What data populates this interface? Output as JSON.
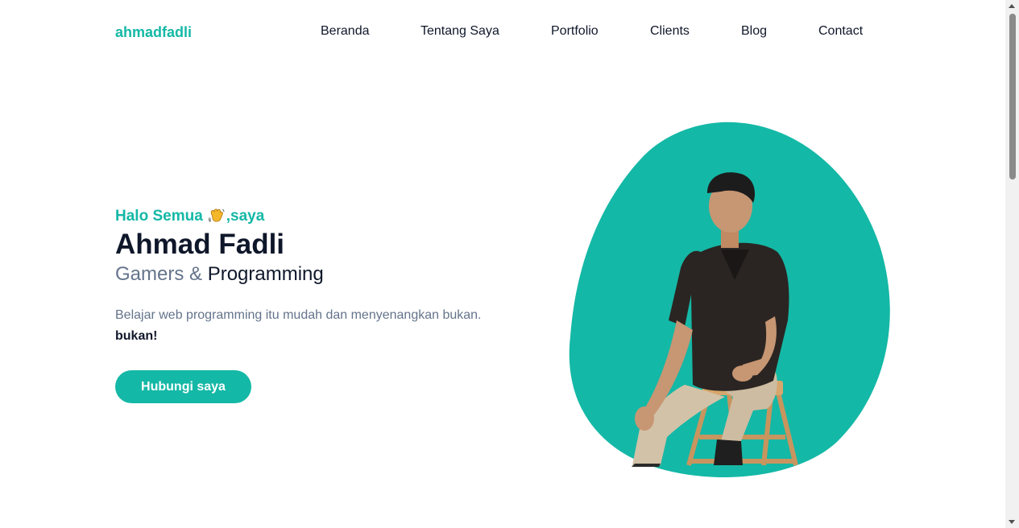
{
  "nav": {
    "brand": "ahmadfadli",
    "links": [
      "Beranda",
      "Tentang Saya",
      "Portfolio",
      "Clients",
      "Blog",
      "Contact"
    ]
  },
  "hero": {
    "greeting_pre": "Halo Semua",
    "greeting_icon": "waving-hand-icon",
    "greeting_post": ",saya",
    "name": "Ahmad Fadli",
    "subtitle_muted": "Gamers & ",
    "subtitle_strong": "Programming",
    "description": "Belajar web programming itu mudah dan menyenangkan bukan.",
    "description_bold": "bukan!",
    "cta_label": "Hubungi saya",
    "image_alt": "Ahmad Fadli"
  },
  "colors": {
    "primary": "#14b8a6",
    "dark": "#0f172a",
    "muted": "#64748b"
  }
}
